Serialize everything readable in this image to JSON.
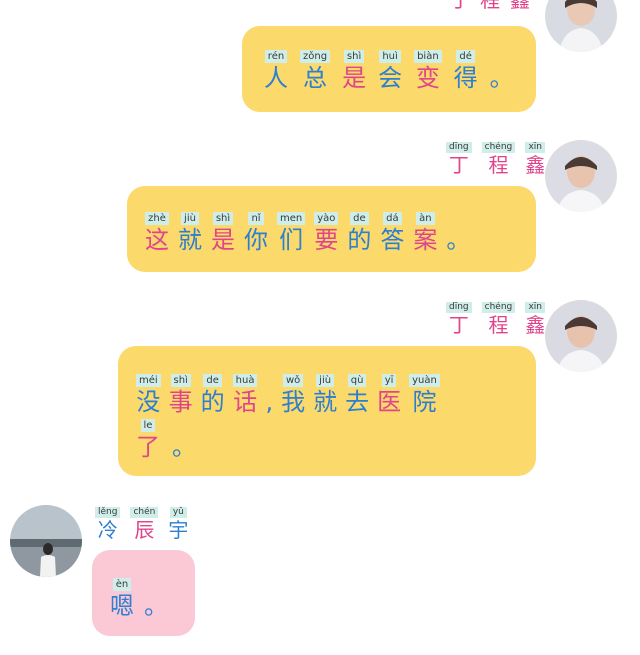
{
  "chat": {
    "sender_right": {
      "name_chars": [
        {
          "py": "dīng",
          "hz": "丁",
          "color": "pink"
        },
        {
          "py": "chéng",
          "hz": "程",
          "color": "pink"
        },
        {
          "py": "xīn",
          "hz": "鑫",
          "color": "pink"
        }
      ]
    },
    "sender_left": {
      "name_chars": [
        {
          "py": "lěng",
          "hz": "冷",
          "color": "blue"
        },
        {
          "py": "chén",
          "hz": "辰",
          "color": "pink"
        },
        {
          "py": "yǔ",
          "hz": "宇",
          "color": "blue"
        }
      ]
    },
    "messages": [
      {
        "side": "right",
        "chars": [
          {
            "py": "rén",
            "hz": "人",
            "color": "blue"
          },
          {
            "py": "zǒng",
            "hz": "总",
            "color": "blue"
          },
          {
            "py": "shì",
            "hz": "是",
            "color": "pink"
          },
          {
            "py": "huì",
            "hz": "会",
            "color": "blue"
          },
          {
            "py": "biàn",
            "hz": "变",
            "color": "pink"
          },
          {
            "py": "dé",
            "hz": "得",
            "color": "blue"
          }
        ],
        "end": "。"
      },
      {
        "side": "right",
        "chars": [
          {
            "py": "zhè",
            "hz": "这",
            "color": "pink"
          },
          {
            "py": "jiù",
            "hz": "就",
            "color": "blue"
          },
          {
            "py": "shì",
            "hz": "是",
            "color": "pink"
          },
          {
            "py": "nǐ",
            "hz": "你",
            "color": "blue"
          },
          {
            "py": "men",
            "hz": "们",
            "color": "blue"
          },
          {
            "py": "yào",
            "hz": "要",
            "color": "pink"
          },
          {
            "py": "de",
            "hz": "的",
            "color": "blue"
          },
          {
            "py": "dá",
            "hz": "答",
            "color": "blue"
          },
          {
            "py": "àn",
            "hz": "案",
            "color": "pink"
          }
        ],
        "end": "。"
      },
      {
        "side": "right",
        "line1": [
          {
            "py": "méi",
            "hz": "没",
            "color": "blue"
          },
          {
            "py": "shì",
            "hz": "事",
            "color": "pink"
          },
          {
            "py": "de",
            "hz": "的",
            "color": "blue"
          },
          {
            "py": "huà",
            "hz": "话",
            "color": "pink"
          }
        ],
        "comma": ",",
        "line1b": [
          {
            "py": "wǒ",
            "hz": "我",
            "color": "blue"
          },
          {
            "py": "jiù",
            "hz": "就",
            "color": "blue"
          },
          {
            "py": "qù",
            "hz": "去",
            "color": "blue"
          },
          {
            "py": "yī",
            "hz": "医",
            "color": "pink"
          },
          {
            "py": "yuàn",
            "hz": "院",
            "color": "blue"
          }
        ],
        "line2": [
          {
            "py": "le",
            "hz": "了",
            "color": "pink"
          }
        ],
        "end": "。"
      },
      {
        "side": "left",
        "chars": [
          {
            "py": "èn",
            "hz": "嗯",
            "color": "blue"
          }
        ],
        "end": "。"
      }
    ]
  }
}
